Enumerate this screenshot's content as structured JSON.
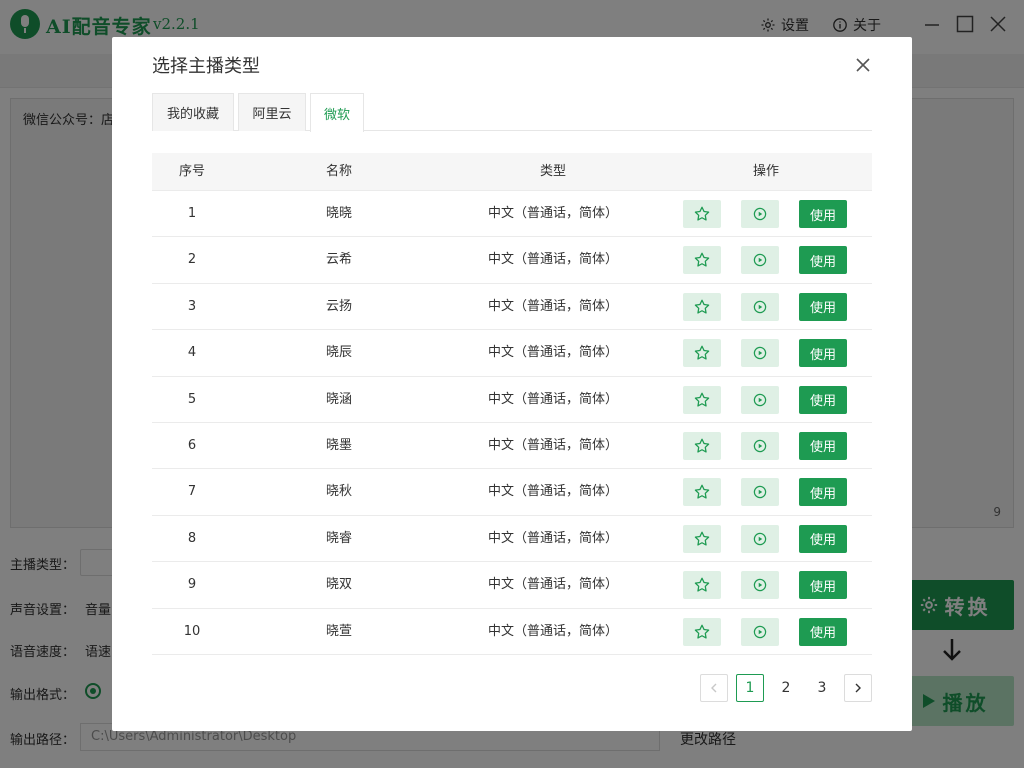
{
  "app": {
    "title": "AI配音专家",
    "version": "v2.2.1",
    "settings_label": "设置",
    "about_label": "关于",
    "editor_text": "微信公众号：店",
    "char_count": "9",
    "form": {
      "anchor_type_label": "主播类型：",
      "voice_settings_label": "声音设置：",
      "volume_label": "音量",
      "speed_label": "语音速度：",
      "speed_sub": "语速",
      "format_label": "输出格式：",
      "path_label": "输出路径：",
      "path_value": "C:\\Users\\Administrator\\Desktop",
      "change_path_label": "更改路径"
    },
    "convert_label": "转换",
    "play_label": "播放"
  },
  "dialog": {
    "title": "选择主播类型",
    "tabs": [
      {
        "label": "我的收藏"
      },
      {
        "label": "阿里云"
      },
      {
        "label": "微软"
      }
    ],
    "active_tab": "微软",
    "table": {
      "headers": [
        "序号",
        "名称",
        "类型",
        "操作"
      ],
      "use_label": "使用",
      "rows": [
        {
          "index": "1",
          "name": "晓晓",
          "type": "中文（普通话，简体）"
        },
        {
          "index": "2",
          "name": "云希",
          "type": "中文（普通话，简体）"
        },
        {
          "index": "3",
          "name": "云扬",
          "type": "中文（普通话，简体）"
        },
        {
          "index": "4",
          "name": "晓辰",
          "type": "中文（普通话，简体）"
        },
        {
          "index": "5",
          "name": "晓涵",
          "type": "中文（普通话，简体）"
        },
        {
          "index": "6",
          "name": "晓墨",
          "type": "中文（普通话，简体）"
        },
        {
          "index": "7",
          "name": "晓秋",
          "type": "中文（普通话，简体）"
        },
        {
          "index": "8",
          "name": "晓睿",
          "type": "中文（普通话，简体）"
        },
        {
          "index": "9",
          "name": "晓双",
          "type": "中文（普通话，简体）"
        },
        {
          "index": "10",
          "name": "晓萱",
          "type": "中文（普通话，简体）"
        }
      ]
    },
    "pagination": {
      "pages": [
        "1",
        "2",
        "3"
      ],
      "current": "1"
    }
  },
  "colors": {
    "brand_green": "#1e9b52",
    "light_green": "#dff0e5",
    "overlay": "rgba(0,0,0,0.5)"
  },
  "icons": {
    "favorite": "star-outline-icon",
    "play": "play-circle-icon",
    "settings": "gear-icon",
    "about": "info-circle-icon",
    "close": "close-icon"
  }
}
